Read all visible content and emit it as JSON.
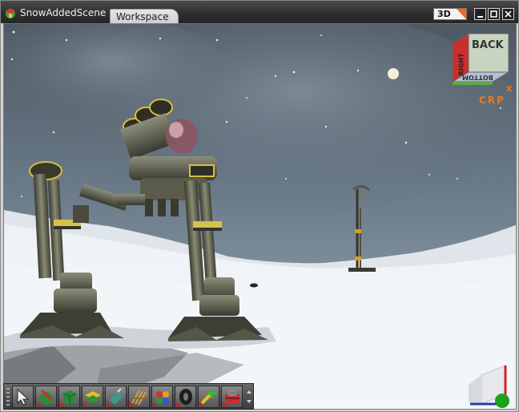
{
  "window": {
    "title": "SnowAddedScene",
    "tab_label": "Workspace",
    "view_mode": "3D",
    "icons": [
      "app-home-icon",
      "minimize-icon",
      "maximize-icon",
      "close-icon"
    ]
  },
  "viewcube": {
    "back_label": "BACK",
    "left_label": "RIGHT",
    "bottom_label": "BOTTOM",
    "crp_label": "CRP",
    "axis_label": "X"
  },
  "toolbar": {
    "tools": [
      {
        "name": "select-arrow-tool"
      },
      {
        "name": "paint-tool"
      },
      {
        "name": "cube-shape-tool"
      },
      {
        "name": "layers-tool"
      },
      {
        "name": "nozzle-tool"
      },
      {
        "name": "fence-tool"
      },
      {
        "name": "color-palette-tool"
      },
      {
        "name": "tire-object-tool"
      },
      {
        "name": "add-light-tool"
      },
      {
        "name": "toolbox-tool"
      }
    ]
  },
  "colors": {
    "accent": "#ef6b16",
    "titlebar": "#333333",
    "sky": "#5f6f7e",
    "snow": "#eef2f6"
  }
}
